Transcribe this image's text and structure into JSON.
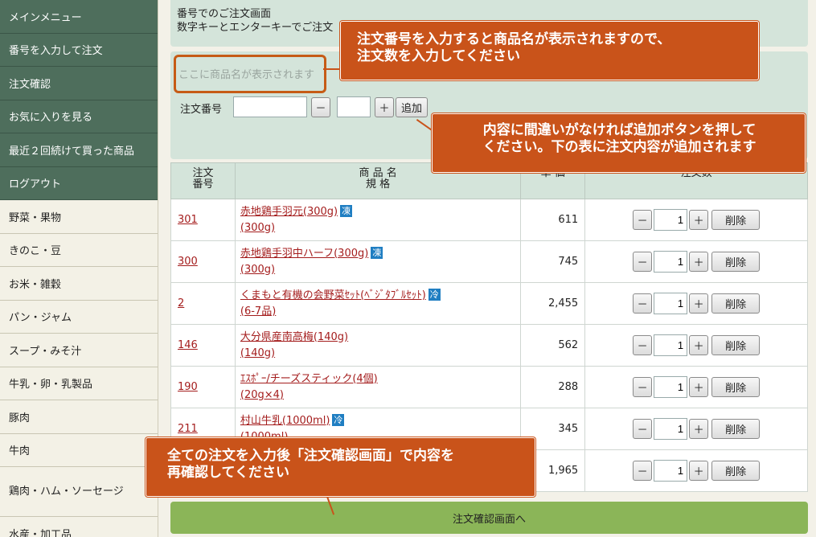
{
  "sidebar": {
    "items": [
      {
        "label": "メインメニュー",
        "style": "dark"
      },
      {
        "label": "番号を入力して注文",
        "style": "dark"
      },
      {
        "label": "注文確認",
        "style": "dark"
      },
      {
        "label": "お気に入りを見る",
        "style": "dark"
      },
      {
        "label": "最近２回続けて買った商品",
        "style": "dark"
      },
      {
        "label": "ログアウト",
        "style": "dark"
      },
      {
        "label": "野菜・果物",
        "style": "light"
      },
      {
        "label": "きのこ・豆",
        "style": "light"
      },
      {
        "label": "お米・雑穀",
        "style": "light"
      },
      {
        "label": "パン・ジャム",
        "style": "light"
      },
      {
        "label": "スープ・みそ汁",
        "style": "light"
      },
      {
        "label": "牛乳・卵・乳製品",
        "style": "light"
      },
      {
        "label": "豚肉",
        "style": "light"
      },
      {
        "label": "牛肉",
        "style": "light"
      },
      {
        "label": "鶏肉・ハム・ソーセージ",
        "style": "light"
      },
      {
        "label": "水産・加工品",
        "style": "light"
      }
    ]
  },
  "header": {
    "title": "番号でのご注文画面",
    "subtitle": "数字キーとエンターキーでご注文"
  },
  "form": {
    "product_placeholder": "ここに商品名が表示されます",
    "order_label": "注文番号",
    "order_value": "",
    "minus": "－",
    "plus": "＋",
    "qty_value": "",
    "add_label": "追加"
  },
  "table": {
    "headers": {
      "no_line1": "注文",
      "no_line2": "番号",
      "name_line1": "商 品 名",
      "name_line2": "規 格",
      "price": "単 価",
      "qty": "注文数"
    },
    "delete_label": "削除",
    "rows": [
      {
        "no": "301",
        "name": "赤地鶏手羽元(300g)",
        "badge": "凍",
        "spec": "(300g)",
        "price": "611",
        "qty": "1"
      },
      {
        "no": "300",
        "name": "赤地鶏手羽中ハーフ(300g)",
        "badge": "凍",
        "spec": "(300g)",
        "price": "745",
        "qty": "1"
      },
      {
        "no": "2",
        "name": "くまもと有機の会野菜ｾｯﾄ(ﾍﾞｼﾞﾀﾌﾞﾙｾｯﾄ)",
        "badge": "冷",
        "spec": "(6-7品)",
        "price": "2,455",
        "qty": "1"
      },
      {
        "no": "146",
        "name": "大分県産南高梅(140g)",
        "badge": "",
        "spec": "(140g)",
        "price": "562",
        "qty": "1"
      },
      {
        "no": "190",
        "name": "ｴｽﾎﾟｰ/チーズスティック(4個)",
        "badge": "",
        "spec": "(20g×4)",
        "price": "288",
        "qty": "1"
      },
      {
        "no": "211",
        "name": "村山牛乳(1000ml)",
        "badge": "冷",
        "spec": "(1000ml)",
        "price": "345",
        "qty": "1"
      },
      {
        "no": "",
        "name": "",
        "badge": "",
        "spec": "",
        "price": "1,965",
        "qty": "1"
      }
    ]
  },
  "confirm_button": "注文確認画面へ",
  "callouts": {
    "c1_line1": "注文番号を入力すると商品名が表示されますので、",
    "c1_line2": "注文数を入力してください",
    "c2_line1": "内容に間違いがなければ追加ボタンを押して",
    "c2_line2": "ください。下の表に注文内容が追加されます",
    "c3_line1": "全ての注文を入力後「注文確認画面」で内容を",
    "c3_line2": "再確認してください"
  },
  "colors": {
    "sidebar_dark": "#4e6e5c",
    "panel": "#d4e4da",
    "callout": "#c9531a",
    "confirm": "#8bb558",
    "link": "#a41d1d",
    "badge": "#1f7ec2"
  }
}
